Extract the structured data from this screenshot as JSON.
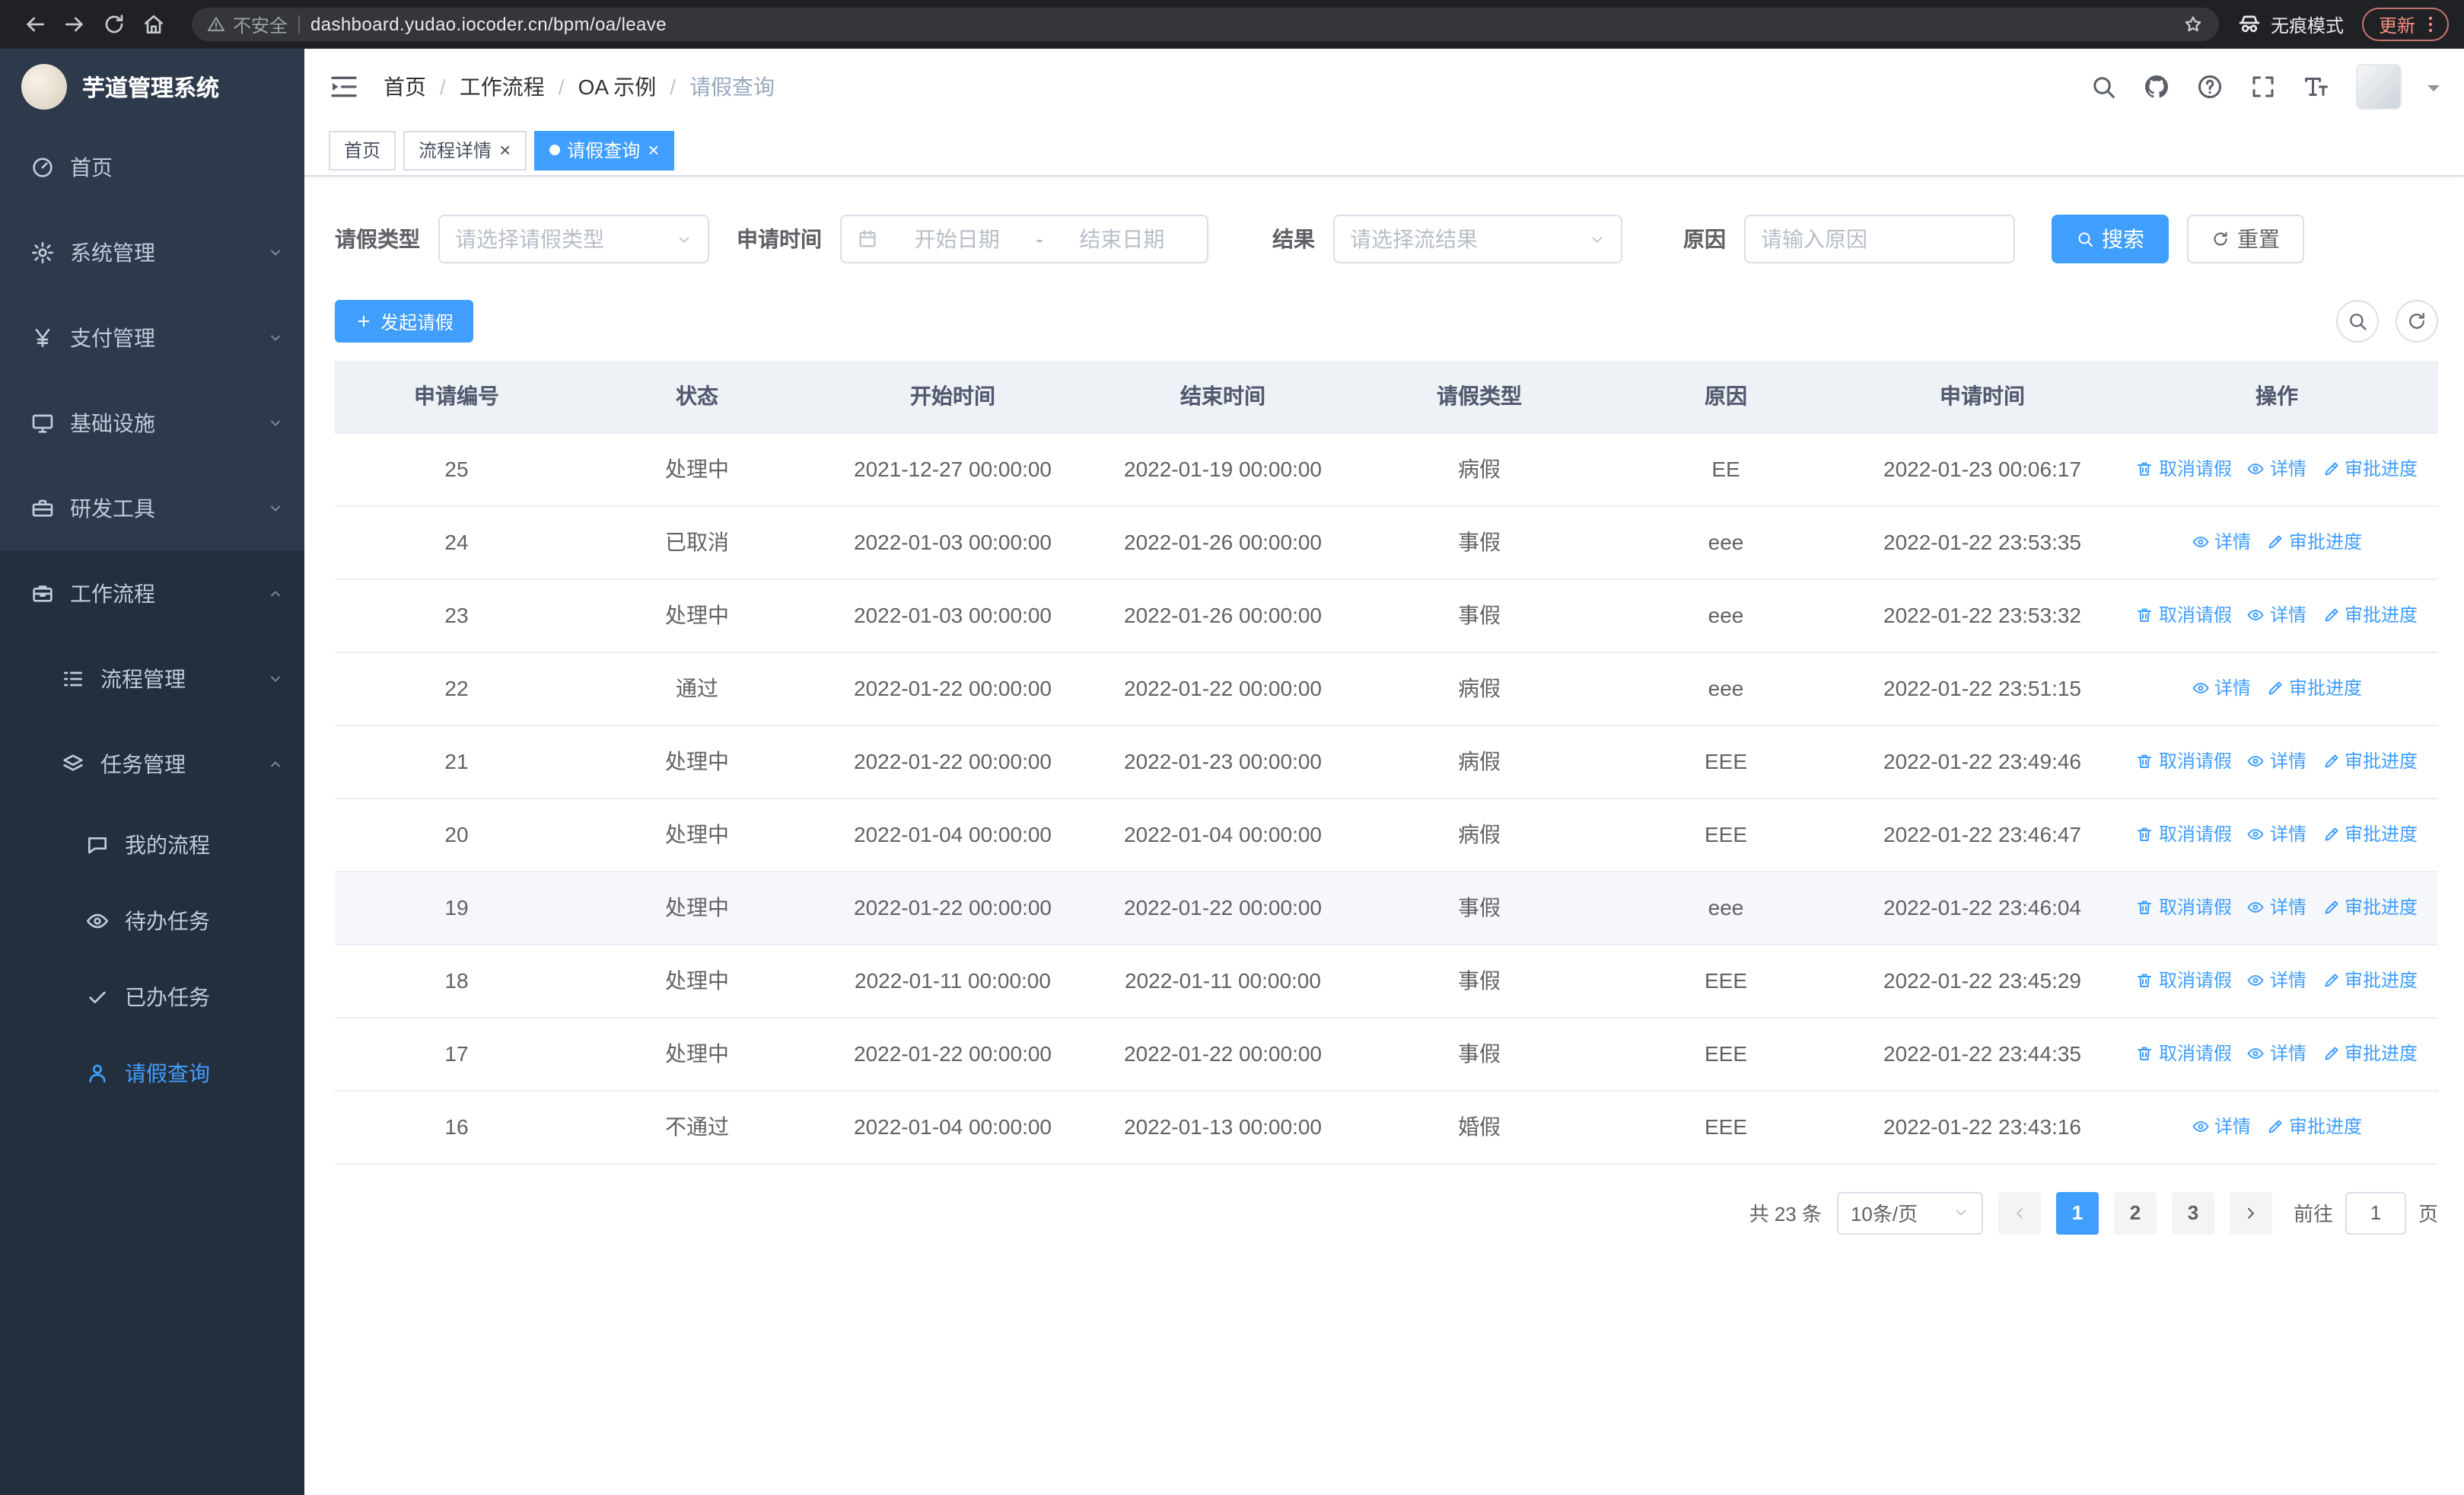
{
  "browser": {
    "security_label": "不安全",
    "url": "dashboard.yudao.iocoder.cn/bpm/oa/leave",
    "incognito_label": "无痕模式",
    "update_label": "更新"
  },
  "app_title": "芋道管理系统",
  "sidebar": {
    "items": [
      {
        "label": "首页",
        "icon": "dashboard-icon"
      },
      {
        "label": "系统管理",
        "icon": "gear-icon"
      },
      {
        "label": "支付管理",
        "icon": "yen-icon"
      },
      {
        "label": "基础设施",
        "icon": "monitor-icon"
      },
      {
        "label": "研发工具",
        "icon": "toolbox-icon"
      },
      {
        "label": "工作流程",
        "icon": "briefcase-icon"
      },
      {
        "label": "流程管理",
        "icon": "list-icon"
      },
      {
        "label": "任务管理",
        "icon": "layers-icon"
      },
      {
        "label": "我的流程",
        "icon": "chat-icon"
      },
      {
        "label": "待办任务",
        "icon": "eye-icon"
      },
      {
        "label": "已办任务",
        "icon": "check-icon"
      },
      {
        "label": "请假查询",
        "icon": "user-icon"
      }
    ]
  },
  "header": {
    "breadcrumb": [
      "首页",
      "工作流程",
      "OA 示例",
      "请假查询"
    ]
  },
  "tabs": [
    {
      "label": "首页"
    },
    {
      "label": "流程详情"
    },
    {
      "label": "请假查询"
    }
  ],
  "filters": {
    "leave_type_label": "请假类型",
    "leave_type_placeholder": "请选择请假类型",
    "apply_time_label": "申请时间",
    "start_date_placeholder": "开始日期",
    "date_separator": "-",
    "end_date_placeholder": "结束日期",
    "result_label": "结果",
    "result_placeholder": "请选择流结果",
    "reason_label": "原因",
    "reason_placeholder": "请输入原因",
    "search_label": "搜索",
    "reset_label": "重置"
  },
  "actions_bar": {
    "create_label": "发起请假"
  },
  "table": {
    "columns": [
      "申请编号",
      "状态",
      "开始时间",
      "结束时间",
      "请假类型",
      "原因",
      "申请时间",
      "操作"
    ],
    "action_labels": {
      "cancel": "取消请假",
      "detail": "详情",
      "progress": "审批进度"
    },
    "rows": [
      {
        "id": "25",
        "status": "处理中",
        "start": "2021-12-27 00:00:00",
        "end": "2022-01-19 00:00:00",
        "type": "病假",
        "reason": "EE",
        "applied": "2022-01-23 00:06:17",
        "actions": [
          "cancel",
          "detail",
          "progress"
        ]
      },
      {
        "id": "24",
        "status": "已取消",
        "start": "2022-01-03 00:00:00",
        "end": "2022-01-26 00:00:00",
        "type": "事假",
        "reason": "eee",
        "applied": "2022-01-22 23:53:35",
        "actions": [
          "detail",
          "progress"
        ]
      },
      {
        "id": "23",
        "status": "处理中",
        "start": "2022-01-03 00:00:00",
        "end": "2022-01-26 00:00:00",
        "type": "事假",
        "reason": "eee",
        "applied": "2022-01-22 23:53:32",
        "actions": [
          "cancel",
          "detail",
          "progress"
        ]
      },
      {
        "id": "22",
        "status": "通过",
        "start": "2022-01-22 00:00:00",
        "end": "2022-01-22 00:00:00",
        "type": "病假",
        "reason": "eee",
        "applied": "2022-01-22 23:51:15",
        "actions": [
          "detail",
          "progress"
        ]
      },
      {
        "id": "21",
        "status": "处理中",
        "start": "2022-01-22 00:00:00",
        "end": "2022-01-23 00:00:00",
        "type": "病假",
        "reason": "EEE",
        "applied": "2022-01-22 23:49:46",
        "actions": [
          "cancel",
          "detail",
          "progress"
        ]
      },
      {
        "id": "20",
        "status": "处理中",
        "start": "2022-01-04 00:00:00",
        "end": "2022-01-04 00:00:00",
        "type": "病假",
        "reason": "EEE",
        "applied": "2022-01-22 23:46:47",
        "actions": [
          "cancel",
          "detail",
          "progress"
        ]
      },
      {
        "id": "19",
        "status": "处理中",
        "start": "2022-01-22 00:00:00",
        "end": "2022-01-22 00:00:00",
        "type": "事假",
        "reason": "eee",
        "applied": "2022-01-22 23:46:04",
        "actions": [
          "cancel",
          "detail",
          "progress"
        ],
        "highlighted": true
      },
      {
        "id": "18",
        "status": "处理中",
        "start": "2022-01-11 00:00:00",
        "end": "2022-01-11 00:00:00",
        "type": "事假",
        "reason": "EEE",
        "applied": "2022-01-22 23:45:29",
        "actions": [
          "cancel",
          "detail",
          "progress"
        ]
      },
      {
        "id": "17",
        "status": "处理中",
        "start": "2022-01-22 00:00:00",
        "end": "2022-01-22 00:00:00",
        "type": "事假",
        "reason": "EEE",
        "applied": "2022-01-22 23:44:35",
        "actions": [
          "cancel",
          "detail",
          "progress"
        ]
      },
      {
        "id": "16",
        "status": "不通过",
        "start": "2022-01-04 00:00:00",
        "end": "2022-01-13 00:00:00",
        "type": "婚假",
        "reason": "EEE",
        "applied": "2022-01-22 23:43:16",
        "actions": [
          "detail",
          "progress"
        ]
      }
    ]
  },
  "pagination": {
    "total_label": "共 23 条",
    "page_size_label": "10条/页",
    "pages": [
      "1",
      "2",
      "3"
    ],
    "active_page": "1",
    "goto_label": "前往",
    "goto_value": "1",
    "goto_suffix": "页"
  }
}
